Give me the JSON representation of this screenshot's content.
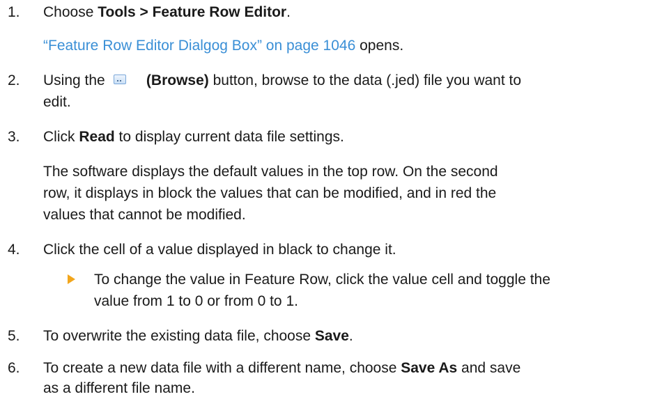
{
  "steps": [
    {
      "num": "1.",
      "parts": [
        "Choose ",
        "Tools > Feature Row Editor",
        "."
      ]
    },
    {
      "note": [
        "“Feature Row Editor Dialgog Box” on page 1046",
        " opens."
      ]
    },
    {
      "num": "2.",
      "parts": [
        "Using the ",
        "(Browse)",
        " button, browse to the data (.jed) file you want to",
        "edit."
      ]
    },
    {
      "num": "3.",
      "parts": [
        "Click ",
        "Read",
        " to display current data file settings."
      ]
    },
    {
      "note": [
        "The software displays the default values in the top row. On the second",
        "row, it displays in block the values that can be modified, and in red the",
        "values that cannot be modified."
      ]
    },
    {
      "num": "4.",
      "parts": [
        "Click the cell of a value displayed in black to change it."
      ]
    },
    {
      "bullet": [
        "To change the value in Feature Row, click the value cell and toggle the",
        "value from 1 to 0 or from 0 to 1."
      ]
    },
    {
      "num": "5.",
      "parts": [
        "To overwrite the existing data file, choose ",
        "Save",
        "."
      ]
    },
    {
      "num": "6.",
      "parts": [
        "To create a new data file with a different name, choose ",
        "Save As",
        " and save",
        "as a different file name."
      ]
    }
  ],
  "icons": {
    "browse": "browse-button-icon"
  },
  "colors": {
    "link": "#3a8fd6",
    "bullet": "#f2a61c",
    "text": "#1a1a1a"
  }
}
